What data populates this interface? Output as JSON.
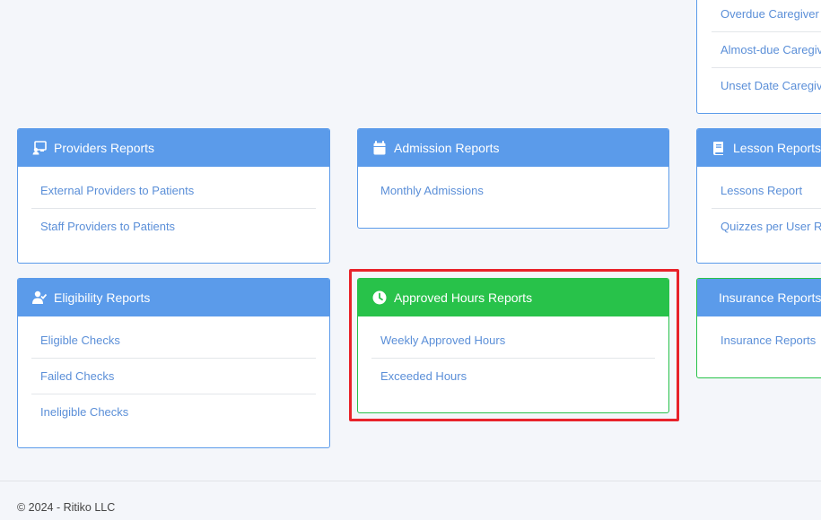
{
  "top_card": {
    "links": [
      "Overdue Caregiver T",
      "Almost-due Caregiv",
      "Unset Date Caregiv"
    ]
  },
  "providers": {
    "title": "Providers Reports",
    "icon": "chalkboard-user-icon",
    "links": [
      "External Providers to Patients",
      "Staff Providers to Patients"
    ]
  },
  "admission": {
    "title": "Admission Reports",
    "icon": "calendar-icon",
    "links": [
      "Monthly Admissions"
    ]
  },
  "lesson": {
    "title": "Lesson Reports",
    "icon": "book-icon",
    "links": [
      "Lessons Report",
      "Quizzes per User Re"
    ]
  },
  "eligibility": {
    "title": "Eligibility Reports",
    "icon": "user-check-icon",
    "links": [
      "Eligible Checks",
      "Failed Checks",
      "Ineligible Checks"
    ]
  },
  "approved_hours": {
    "title": "Approved Hours Reports",
    "icon": "clock-icon",
    "links": [
      "Weekly Approved Hours",
      "Exceeded Hours"
    ]
  },
  "insurance": {
    "title": "Insurance Reports",
    "links": [
      "Insurance Reports"
    ]
  },
  "footer": {
    "text": "© 2024 - Ritiko LLC"
  },
  "colors": {
    "primary": "#5b9bea",
    "success": "#28c24a",
    "highlight": "#e8232a",
    "link": "#5b8fd8"
  }
}
